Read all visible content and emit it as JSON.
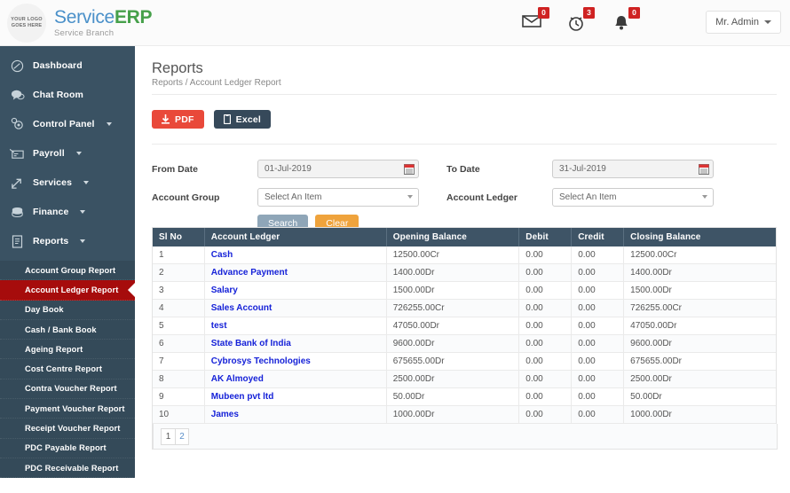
{
  "header": {
    "logo_line1": "YOUR LOGO",
    "logo_line2": "GOES HERE",
    "brand_service": "Service",
    "brand_erp": "ERP",
    "brand_sub": "Service Branch",
    "icons": [
      {
        "name": "mail-icon",
        "count": "0"
      },
      {
        "name": "alarm-clock-icon",
        "count": "3"
      },
      {
        "name": "bell-icon",
        "count": "0"
      }
    ],
    "user": "Mr. Admin"
  },
  "sidebar": {
    "items": [
      {
        "label": "Dashboard",
        "icon": "dashboard-icon",
        "caret": false
      },
      {
        "label": "Chat Room",
        "icon": "chat-icon",
        "caret": false
      },
      {
        "label": "Control Panel",
        "icon": "gear-icon",
        "caret": true
      },
      {
        "label": "Payroll",
        "icon": "payroll-card-icon",
        "caret": true
      },
      {
        "label": "Services",
        "icon": "services-arrow-icon",
        "caret": true
      },
      {
        "label": "Finance",
        "icon": "coins-icon",
        "caret": true
      },
      {
        "label": "Reports",
        "icon": "report-document-icon",
        "caret": true
      }
    ],
    "submenu": [
      {
        "label": "Account Group Report",
        "active": false
      },
      {
        "label": "Account Ledger Report",
        "active": true
      },
      {
        "label": "Day Book",
        "active": false
      },
      {
        "label": "Cash / Bank Book",
        "active": false
      },
      {
        "label": "Ageing Report",
        "active": false
      },
      {
        "label": "Cost Centre Report",
        "active": false
      },
      {
        "label": "Contra Voucher Report",
        "active": false
      },
      {
        "label": "Payment Voucher Report",
        "active": false
      },
      {
        "label": "Receipt Voucher Report",
        "active": false
      },
      {
        "label": "PDC Payable Report",
        "active": false
      },
      {
        "label": "PDC Receivable Report",
        "active": false
      }
    ]
  },
  "page": {
    "title": "Reports",
    "breadcrumb": "Reports / Account Ledger Report",
    "export": {
      "pdf": "PDF",
      "excel": "Excel"
    }
  },
  "filters": {
    "from_date_label": "From Date",
    "from_date_value": "01-Jul-2019",
    "to_date_label": "To Date",
    "to_date_value": "31-Jul-2019",
    "account_group_label": "Account Group",
    "account_group_value": "Select An Item",
    "account_ledger_label": "Account Ledger",
    "account_ledger_value": "Select An Item",
    "search_button": "Search",
    "clear_button": "Clear"
  },
  "table": {
    "columns": [
      "Sl No",
      "Account Ledger",
      "Opening Balance",
      "Debit",
      "Credit",
      "Closing Balance"
    ],
    "rows": [
      {
        "sl": "1",
        "ledger": "Cash",
        "opening": "12500.00Cr",
        "debit": "0.00",
        "credit": "0.00",
        "closing": "12500.00Cr"
      },
      {
        "sl": "2",
        "ledger": "Advance Payment",
        "opening": "1400.00Dr",
        "debit": "0.00",
        "credit": "0.00",
        "closing": "1400.00Dr"
      },
      {
        "sl": "3",
        "ledger": "Salary",
        "opening": "1500.00Dr",
        "debit": "0.00",
        "credit": "0.00",
        "closing": "1500.00Dr"
      },
      {
        "sl": "4",
        "ledger": "Sales Account",
        "opening": "726255.00Cr",
        "debit": "0.00",
        "credit": "0.00",
        "closing": "726255.00Cr"
      },
      {
        "sl": "5",
        "ledger": "test",
        "opening": "47050.00Dr",
        "debit": "0.00",
        "credit": "0.00",
        "closing": "47050.00Dr"
      },
      {
        "sl": "6",
        "ledger": "State Bank of India",
        "opening": "9600.00Dr",
        "debit": "0.00",
        "credit": "0.00",
        "closing": "9600.00Dr"
      },
      {
        "sl": "7",
        "ledger": "Cybrosys Technologies",
        "opening": "675655.00Dr",
        "debit": "0.00",
        "credit": "0.00",
        "closing": "675655.00Dr"
      },
      {
        "sl": "8",
        "ledger": "AK Almoyed",
        "opening": "2500.00Dr",
        "debit": "0.00",
        "credit": "0.00",
        "closing": "2500.00Dr"
      },
      {
        "sl": "9",
        "ledger": "Mubeen pvt ltd",
        "opening": "50.00Dr",
        "debit": "0.00",
        "credit": "0.00",
        "closing": "50.00Dr"
      },
      {
        "sl": "10",
        "ledger": "James",
        "opening": "1000.00Dr",
        "debit": "0.00",
        "credit": "0.00",
        "closing": "1000.00Dr"
      }
    ]
  },
  "pagination": {
    "pages": [
      "1",
      "2"
    ],
    "current": "1"
  },
  "colors": {
    "sidebar": "#3a5263",
    "submenu": "#344a59",
    "active": "#a60c0c",
    "table_header": "#3e5466",
    "pdf": "#e9493a",
    "excel": "#36495a",
    "search": "#8fa6b8",
    "clear": "#efa33c",
    "link": "#1622d8",
    "badge": "#cf2222"
  }
}
